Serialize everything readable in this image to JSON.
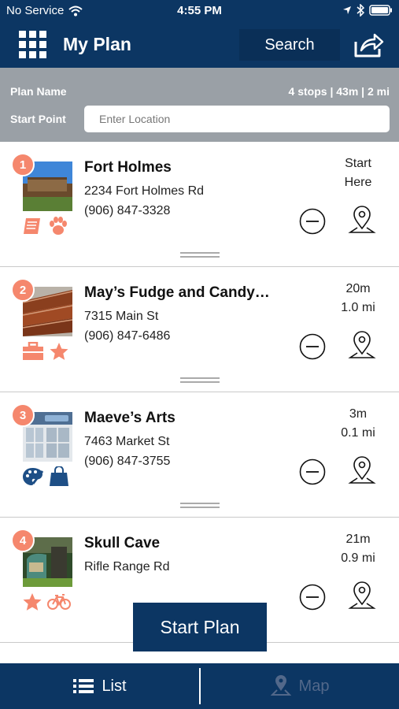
{
  "status_bar": {
    "carrier": "No Service",
    "time": "4:55 PM"
  },
  "nav": {
    "title": "My Plan",
    "search_label": "Search",
    "icons": [
      "grid-menu-icon",
      "share-icon"
    ]
  },
  "plan": {
    "name_label": "Plan Name",
    "summary": "4 stops | 43m | 2 mi",
    "start_label": "Start Point",
    "location_placeholder": "Enter Location"
  },
  "stops": [
    {
      "number": "1",
      "name": "Fort Holmes",
      "address": "2234 Fort Holmes Rd",
      "phone": "(906) 847-3328",
      "timing_line1": "Start",
      "timing_line2": "Here",
      "category_icons": [
        "book-icon",
        "paw-icon"
      ]
    },
    {
      "number": "2",
      "name": "May’s Fudge and Candy…",
      "address": "7315 Main St",
      "phone": "(906) 847-6486",
      "timing_line1": "20m",
      "timing_line2": "1.0 mi",
      "category_icons": [
        "briefcase-icon",
        "star-icon"
      ]
    },
    {
      "number": "3",
      "name": "Maeve’s Arts",
      "address": "7463 Market St",
      "phone": "(906) 847-3755",
      "timing_line1": "3m",
      "timing_line2": "0.1 mi",
      "category_icons": [
        "palette-icon",
        "shopping-bag-icon"
      ]
    },
    {
      "number": "4",
      "name": "Skull Cave",
      "address": "Rifle Range Rd",
      "phone": "",
      "timing_line1": "21m",
      "timing_line2": "0.9 mi",
      "category_icons": [
        "star-icon",
        "bicycle-icon"
      ]
    }
  ],
  "start_plan_label": "Start Plan",
  "tabs": {
    "list_label": "List",
    "map_label": "Map"
  },
  "colors": {
    "navy": "#0c3663",
    "accent_coral": "#f5876d",
    "panel_gray": "#9aa0a6",
    "icon_blue": "#1e4f86",
    "inactive_tab": "#52688a"
  }
}
